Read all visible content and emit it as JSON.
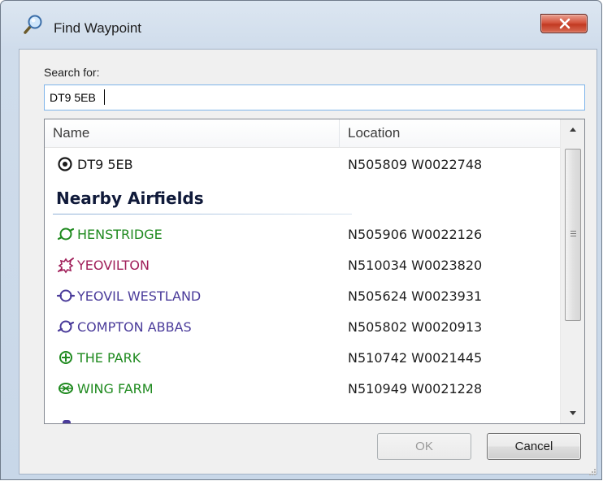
{
  "window": {
    "title": "Find Waypoint",
    "title_icon": "magnifier-icon",
    "close_icon": "close-icon"
  },
  "search": {
    "label": "Search for:",
    "value": "DT9 5EB"
  },
  "list": {
    "columns": {
      "name": "Name",
      "location": "Location"
    },
    "search_result": {
      "name": "DT9 5EB",
      "location": "N505809 W0022748",
      "icon": "target-icon",
      "color": "#1a1a1a"
    },
    "group_title": "Nearby Airfields",
    "airfields": [
      {
        "name": "HENSTRIDGE",
        "location": "N505906 W0022126",
        "icon": "airfield-civil-icon",
        "color": "#1f8a1f"
      },
      {
        "name": "YEOVILTON",
        "location": "N510034 W0023820",
        "icon": "airfield-military-icon",
        "color": "#a0205a"
      },
      {
        "name": "YEOVIL WESTLAND",
        "location": "N505624 W0023931",
        "icon": "airfield-civil-icon",
        "color": "#4a3b9a"
      },
      {
        "name": "COMPTON ABBAS",
        "location": "N505802 W0020913",
        "icon": "airfield-civil-icon",
        "color": "#4a3b9a"
      },
      {
        "name": "THE PARK",
        "location": "N510742 W0021445",
        "icon": "airstrip-icon",
        "color": "#1f8a1f"
      },
      {
        "name": "WING FARM",
        "location": "N510949 W0021228",
        "icon": "airfield-grass-icon",
        "color": "#1f8a1f"
      }
    ]
  },
  "buttons": {
    "ok": "OK",
    "cancel": "Cancel"
  },
  "colors": {
    "accent_border": "#7eb4ea",
    "close_button": "#c23a22",
    "group_title": "#101a3a"
  }
}
